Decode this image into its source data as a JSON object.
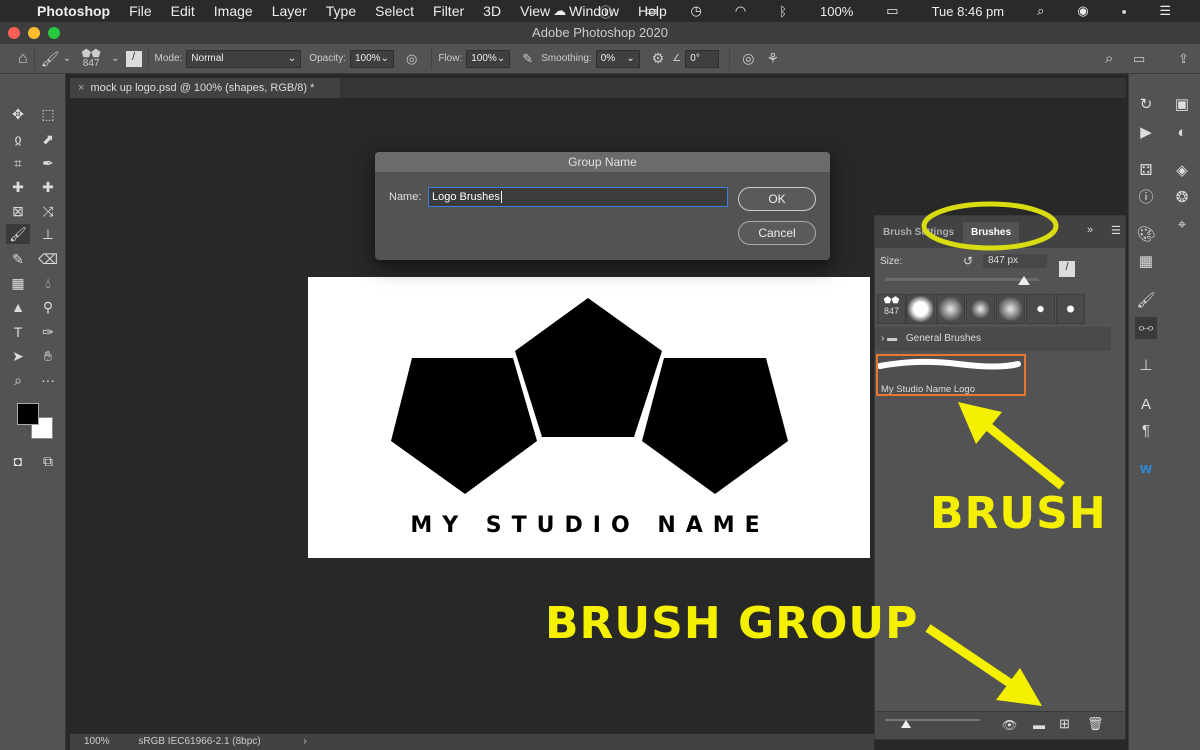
{
  "menubar": {
    "apple": "",
    "app": "Photoshop",
    "items": [
      "File",
      "Edit",
      "Image",
      "Layer",
      "Type",
      "Select",
      "Filter",
      "3D",
      "View",
      "Window",
      "Help"
    ],
    "battery": "100%",
    "clock": "Tue 8:46 pm"
  },
  "window": {
    "title": "Adobe Photoshop 2020"
  },
  "options": {
    "brush_size": "847",
    "mode_label": "Mode:",
    "mode_value": "Normal",
    "opacity_label": "Opacity:",
    "opacity_value": "100%",
    "flow_label": "Flow:",
    "flow_value": "100%",
    "smoothing_label": "Smoothing:",
    "smoothing_value": "0%",
    "angle_value": "0°"
  },
  "document_tab": {
    "title": "mock up logo.psd @ 100% (shapes, RGB/8) *"
  },
  "dialog": {
    "title": "Group Name",
    "name_label": "Name:",
    "name_value": "Logo Brushes",
    "ok": "OK",
    "cancel": "Cancel"
  },
  "canvas": {
    "logo_text": "MY STUDIO NAME"
  },
  "brush_panel": {
    "tabs": [
      "Brush Settings",
      "Brushes"
    ],
    "active_tab": "Brushes",
    "size_label": "Size:",
    "size_value": "847 px",
    "size_slider_fraction": 0.6,
    "preset_label": "847",
    "group": "General Brushes",
    "brush_item": "My Studio Name Logo"
  },
  "status": {
    "zoom": "100%",
    "profile": "sRGB IEC61966-2.1 (8bpc)"
  },
  "annotations": {
    "brush": "BRUSH",
    "brush_group": "BRUSH GROUP",
    "color": "#f5f000",
    "highlight_color": "#e8772e"
  }
}
